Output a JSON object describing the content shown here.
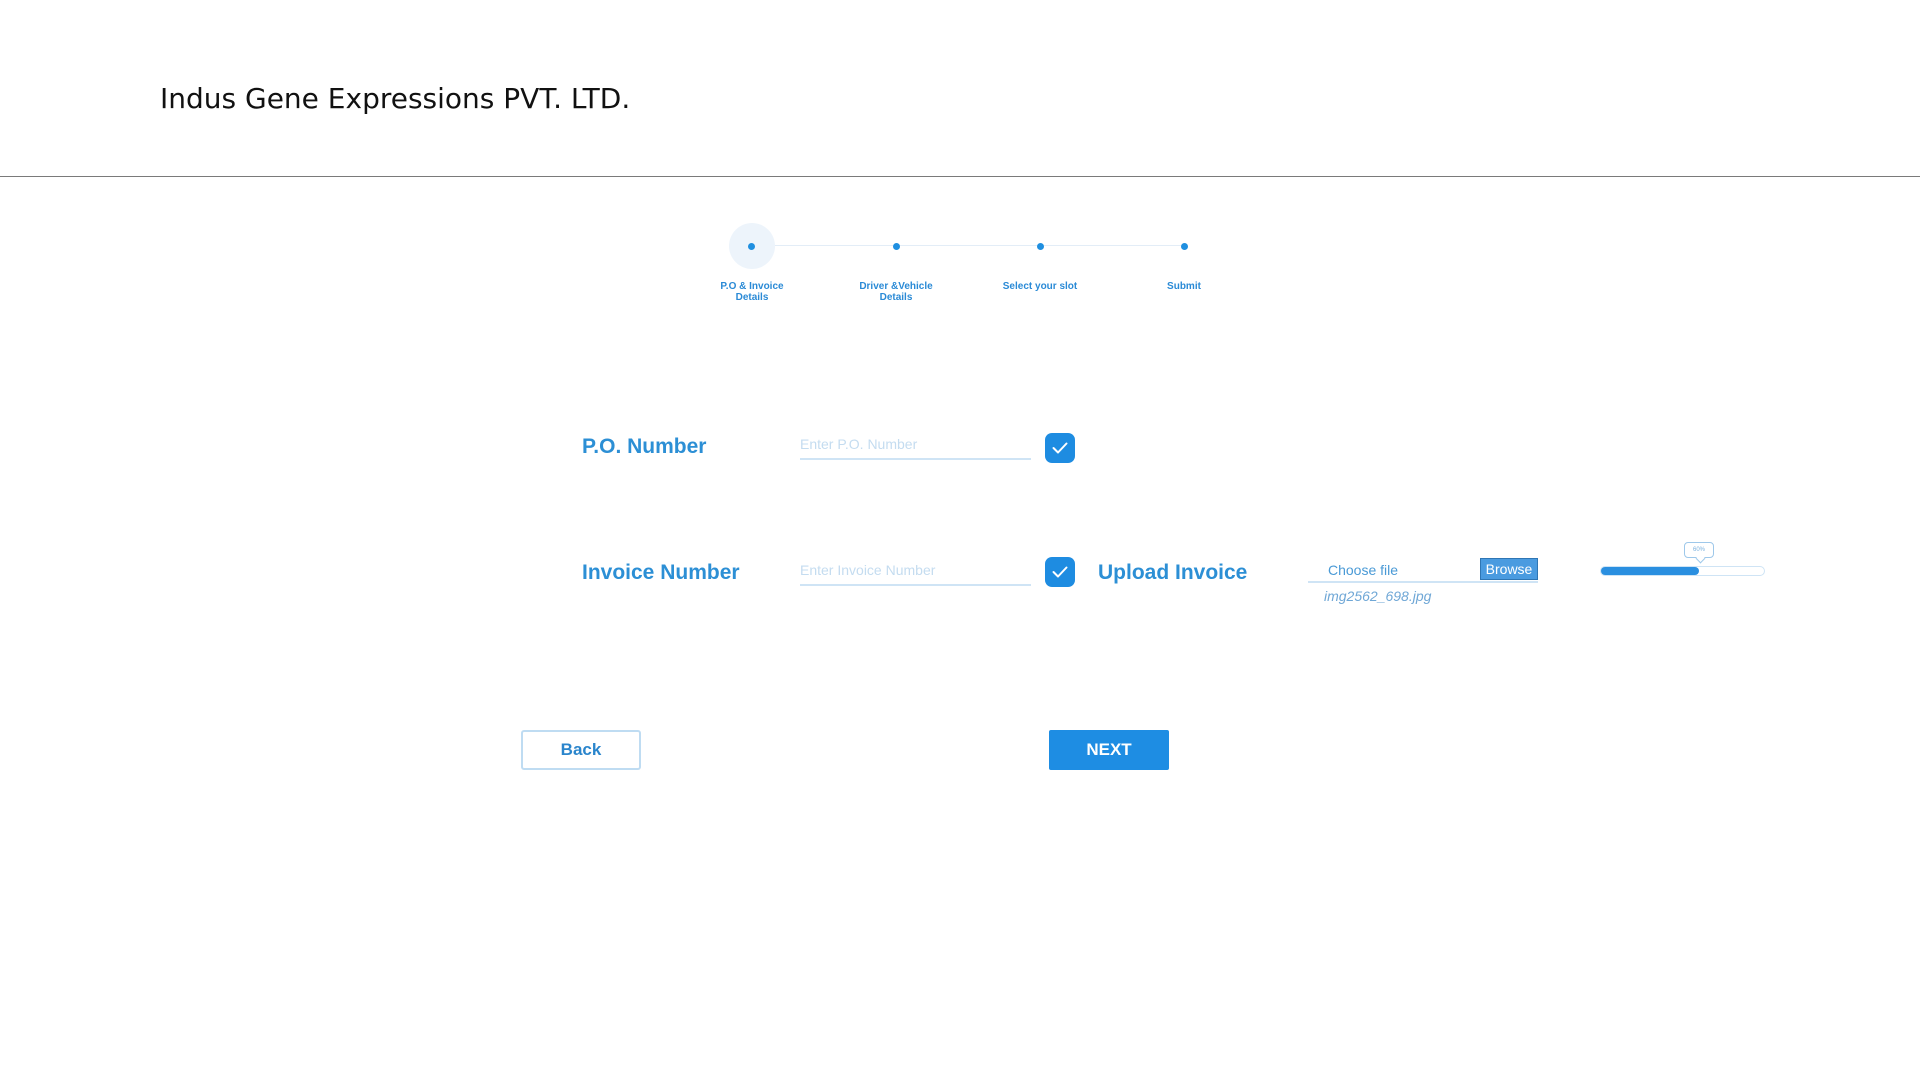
{
  "header": {
    "company_name": "Indus Gene Expressions PVT. LTD."
  },
  "stepper": {
    "steps": [
      {
        "label": "P.O & Invoice Details",
        "active": true
      },
      {
        "label": "Driver &Vehicle Details",
        "active": false
      },
      {
        "label": "Select your slot",
        "active": false
      },
      {
        "label": "Submit",
        "active": false
      }
    ]
  },
  "form": {
    "po_number": {
      "label": "P.O. Number",
      "value": "",
      "placeholder": "Enter P.O. Number"
    },
    "invoice_number": {
      "label": "Invoice Number",
      "value": "",
      "placeholder": "Enter Invoice Number"
    },
    "upload_invoice": {
      "label": "Upload Invoice",
      "choose_text": "Choose file",
      "browse_label": "Browse",
      "file_name": "img2562_698.jpg",
      "progress_percent": 60,
      "progress_label": "60%"
    }
  },
  "actions": {
    "back_label": "Back",
    "next_label": "NEXT"
  },
  "colors": {
    "accent": "#1e8de3",
    "label": "#2c8fd5"
  },
  "icons": {
    "check": "check-icon"
  }
}
